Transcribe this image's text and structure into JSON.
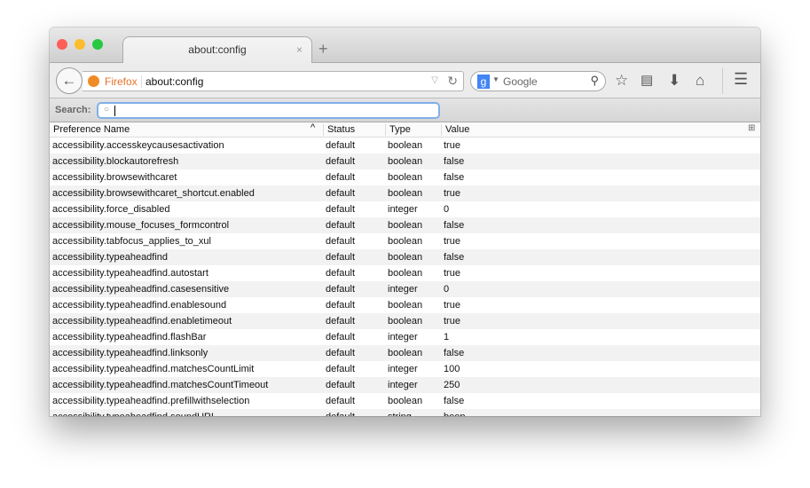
{
  "tab": {
    "title": "about:config",
    "close": "×",
    "new_tab": "+"
  },
  "nav": {
    "identity": "Firefox",
    "url": "about:config",
    "search_placeholder": "Google",
    "search_engine": "g"
  },
  "search": {
    "label": "Search:",
    "value": ""
  },
  "columns": [
    "Preference Name",
    "Status",
    "Type",
    "Value"
  ],
  "rows": [
    [
      "accessibility.accesskeycausesactivation",
      "default",
      "boolean",
      "true"
    ],
    [
      "accessibility.blockautorefresh",
      "default",
      "boolean",
      "false"
    ],
    [
      "accessibility.browsewithcaret",
      "default",
      "boolean",
      "false"
    ],
    [
      "accessibility.browsewithcaret_shortcut.enabled",
      "default",
      "boolean",
      "true"
    ],
    [
      "accessibility.force_disabled",
      "default",
      "integer",
      "0"
    ],
    [
      "accessibility.mouse_focuses_formcontrol",
      "default",
      "boolean",
      "false"
    ],
    [
      "accessibility.tabfocus_applies_to_xul",
      "default",
      "boolean",
      "true"
    ],
    [
      "accessibility.typeaheadfind",
      "default",
      "boolean",
      "false"
    ],
    [
      "accessibility.typeaheadfind.autostart",
      "default",
      "boolean",
      "true"
    ],
    [
      "accessibility.typeaheadfind.casesensitive",
      "default",
      "integer",
      "0"
    ],
    [
      "accessibility.typeaheadfind.enablesound",
      "default",
      "boolean",
      "true"
    ],
    [
      "accessibility.typeaheadfind.enabletimeout",
      "default",
      "boolean",
      "true"
    ],
    [
      "accessibility.typeaheadfind.flashBar",
      "default",
      "integer",
      "1"
    ],
    [
      "accessibility.typeaheadfind.linksonly",
      "default",
      "boolean",
      "false"
    ],
    [
      "accessibility.typeaheadfind.matchesCountLimit",
      "default",
      "integer",
      "100"
    ],
    [
      "accessibility.typeaheadfind.matchesCountTimeout",
      "default",
      "integer",
      "250"
    ],
    [
      "accessibility.typeaheadfind.prefillwithselection",
      "default",
      "boolean",
      "false"
    ],
    [
      "accessibility.typeaheadfind.soundURL",
      "default",
      "string",
      "beep"
    ]
  ]
}
